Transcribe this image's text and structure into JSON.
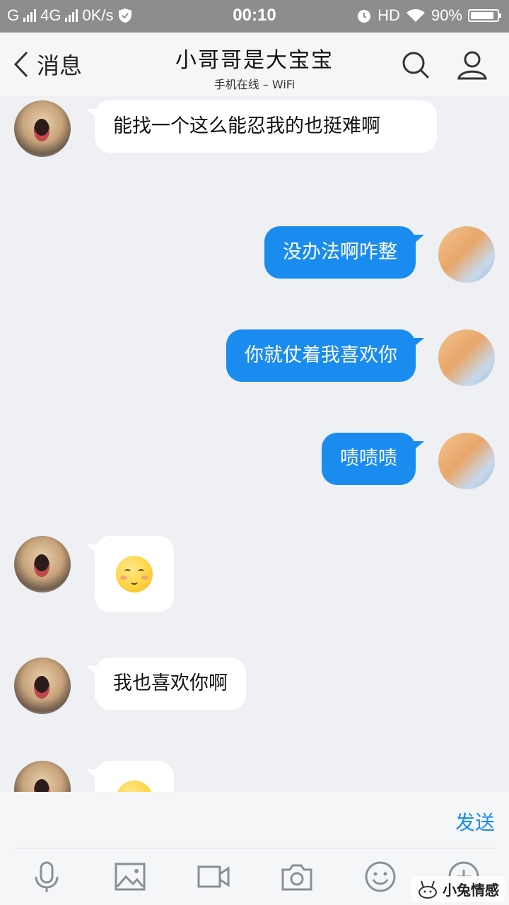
{
  "status_bar": {
    "carrier1": "G",
    "network": "4G",
    "speed": "0K/s",
    "time": "00:10",
    "hd": "HD",
    "battery_percent": "90%",
    "battery_level": 0.9
  },
  "header": {
    "back_label": "消息",
    "contact_name": "小哥哥是大宝宝",
    "status": "手机在线 – WiFi",
    "search_icon": "search-icon",
    "profile_icon": "person-icon"
  },
  "messages": [
    {
      "side": "in",
      "text": "能找一个这么能忍我的也挺难啊"
    },
    {
      "side": "out",
      "text": "没办法啊咋整"
    },
    {
      "side": "out",
      "text": "你就仗着我喜欢你"
    },
    {
      "side": "out",
      "text": "啧啧啧"
    },
    {
      "side": "in",
      "emoji": "shy-smile-emoji"
    },
    {
      "side": "in",
      "text": "我也喜欢你啊"
    },
    {
      "side": "in",
      "emoji": "shy-smile-emoji"
    }
  ],
  "input_bar": {
    "placeholder": "",
    "send_label": "发送"
  },
  "toolbar": {
    "icons": [
      "microphone-icon",
      "image-icon",
      "video-icon",
      "camera-icon",
      "emoji-icon",
      "plus-icon"
    ]
  },
  "watermark": {
    "text": "小兔情感"
  },
  "colors": {
    "accent": "#1a8cf0",
    "background": "#eef0f3",
    "bubble_in": "#ffffff"
  }
}
